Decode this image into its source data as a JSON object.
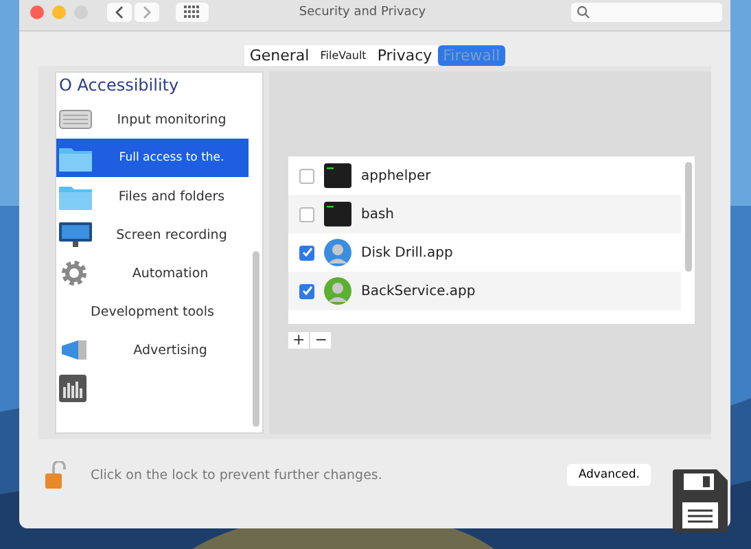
{
  "window": {
    "title": "Security and Privacy"
  },
  "tabs": [
    {
      "label": "General",
      "selected": false
    },
    {
      "label": "FileVault",
      "selected": false
    },
    {
      "label": "Privacy",
      "selected": false
    },
    {
      "label": "Firewall",
      "selected": true
    }
  ],
  "sidebar": {
    "heading": "O Accessibility",
    "items": [
      {
        "label": "Input monitoring",
        "kind": "keyboard",
        "selected": false
      },
      {
        "label": "Full access to the.",
        "kind": "folder",
        "selected": true
      },
      {
        "label": "Files and folders",
        "kind": "folder",
        "selected": false
      },
      {
        "label": "Screen recording",
        "kind": "monitor",
        "selected": false
      },
      {
        "label": "Automation",
        "kind": "gear",
        "selected": false
      },
      {
        "label": "Development tools",
        "kind": "none",
        "selected": false
      },
      {
        "label": "Advertising",
        "kind": "megaphone",
        "selected": false
      },
      {
        "kind": "chart",
        "selected": false
      }
    ]
  },
  "apps": [
    {
      "name": "apphelper",
      "kind": "terminal",
      "checked": false
    },
    {
      "name": "bash",
      "kind": "terminal",
      "checked": false
    },
    {
      "name": "Disk Drill.app",
      "kind": "avatar",
      "color": "#3a8ee0",
      "checked": true
    },
    {
      "name": "BackService.app",
      "kind": "avatar",
      "color": "#5cb030",
      "checked": true
    }
  ],
  "list_buttons": [
    "+",
    "−"
  ],
  "footer": {
    "lock_text": "Click on the lock to prevent further changes.",
    "button": "Advanced."
  }
}
